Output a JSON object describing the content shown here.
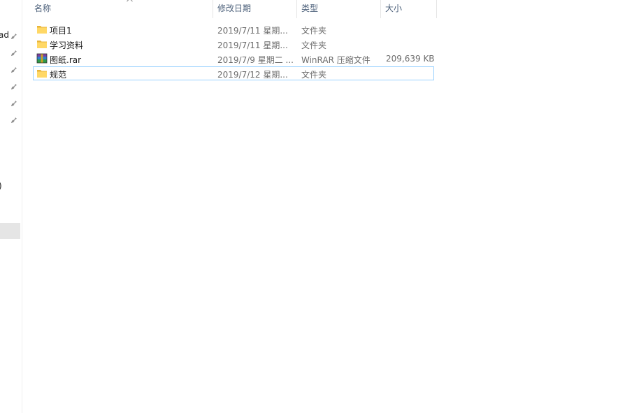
{
  "navigation": {
    "items": [
      {
        "label": "ad",
        "pinned": true
      },
      {
        "label": "",
        "pinned": true
      },
      {
        "label": "",
        "pinned": true
      },
      {
        "label": "",
        "pinned": true
      },
      {
        "label": "",
        "pinned": true
      },
      {
        "label": "",
        "pinned": true
      },
      {
        "label": ")",
        "pinned": false
      }
    ]
  },
  "columns": {
    "name": "名称",
    "modified": "修改日期",
    "type": "类型",
    "size": "大小"
  },
  "files": [
    {
      "name": "项目1",
      "modified": "2019/7/11 星期...",
      "type": "文件夹",
      "size": "",
      "icon": "folder-icon"
    },
    {
      "name": "学习资料",
      "modified": "2019/7/11 星期...",
      "type": "文件夹",
      "size": "",
      "icon": "folder-icon"
    },
    {
      "name": "图纸.rar",
      "modified": "2019/7/9 星期二 ...",
      "type": "WinRAR 压缩文件",
      "size": "209,639 KB",
      "icon": "winrar-archive-icon"
    },
    {
      "name": "规范",
      "modified": "2019/7/12 星期...",
      "type": "文件夹",
      "size": "",
      "icon": "folder-icon"
    }
  ],
  "colors": {
    "header_text": "#4c607a",
    "focus_border": "#99d1ff",
    "folder_yellow": "#ffd866"
  }
}
